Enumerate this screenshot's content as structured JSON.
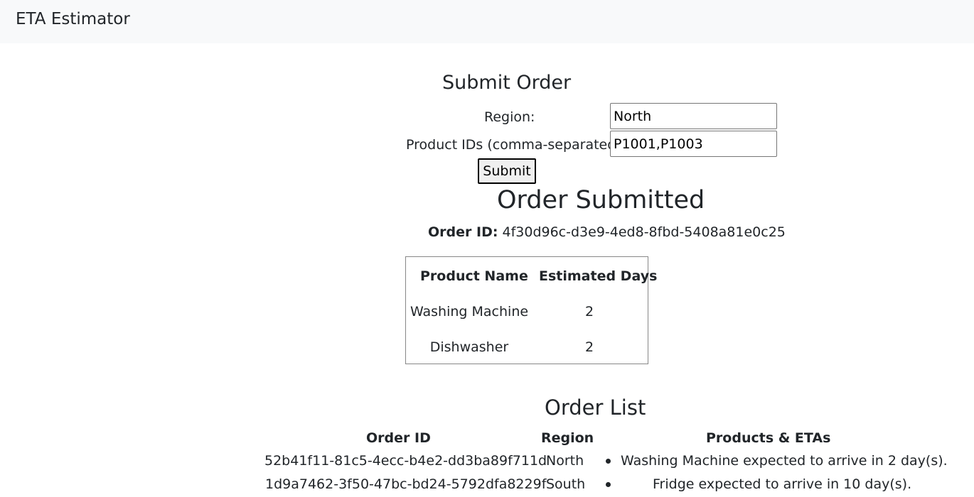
{
  "navbar": {
    "brand": "ETA Estimator"
  },
  "form": {
    "title": "Submit Order",
    "region_label": "Region:",
    "region_value": "North",
    "products_label": "Product IDs (comma-separated):",
    "products_value": "P1001,P1003",
    "submit_label": "Submit"
  },
  "result": {
    "title": "Order Submitted",
    "order_id_label": "Order ID:",
    "order_id": "4f30d96c-d3e9-4ed8-8fbd-5408a81e0c25",
    "headers": {
      "name": "Product Name",
      "days": "Estimated Days"
    },
    "rows": [
      {
        "name": "Washing Machine",
        "days": "2"
      },
      {
        "name": "Dishwasher",
        "days": "2"
      }
    ]
  },
  "order_list": {
    "title": "Order List",
    "headers": {
      "id": "Order ID",
      "region": "Region",
      "products": "Products & ETAs"
    },
    "rows": [
      {
        "id": "52b41f11-81c5-4ecc-b4e2-dd3ba89f711d",
        "region": "North",
        "eta": "Washing Machine expected to arrive in 2 day(s)."
      },
      {
        "id": "1d9a7462-3f50-47bc-bd24-5792dfa8229f",
        "region": "South",
        "eta": "Fridge expected to arrive in 10 day(s)."
      }
    ]
  }
}
